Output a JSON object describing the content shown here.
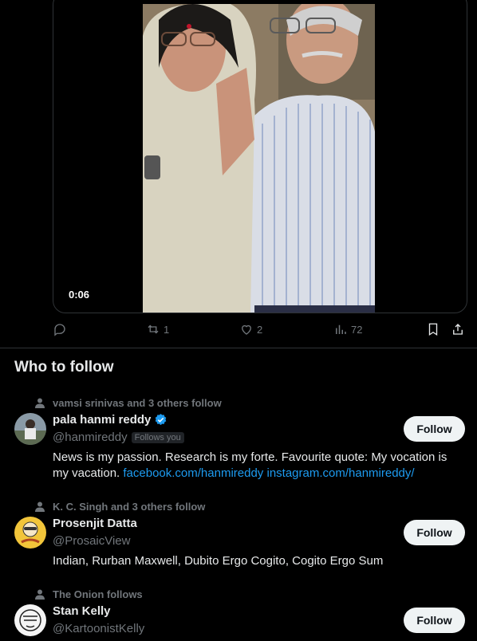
{
  "video": {
    "duration": "0:06"
  },
  "actions": {
    "reposts": "1",
    "likes": "2",
    "views": "72"
  },
  "who_to_follow": {
    "title": "Who to follow",
    "follow_label": "Follow",
    "users": [
      {
        "social": "vamsi srinivas and 3 others follow",
        "name": "pala hanmi reddy",
        "handle": "@hanmireddy",
        "follows_you": "Follows you",
        "bio": "News is my passion. Research is my forte. Favourite quote: My vocation is my vacation.",
        "link1": "facebook.com/hanmireddy",
        "link2": "instagram.com/hanmireddy/"
      },
      {
        "social": "K. C. Singh and 3 others follow",
        "name": "Prosenjit Datta",
        "handle": "@ProsaicView",
        "bio": "Indian, Rurban Maxwell, Dubito Ergo Cogito, Cogito Ergo Sum"
      },
      {
        "social": "The Onion follows",
        "name": "Stan Kelly",
        "handle": "@KartoonistKelly"
      }
    ]
  },
  "colors": {
    "accent": "#1d9bf0",
    "muted": "#71767b",
    "border": "#2f3336",
    "verified": "#1d9bf0"
  }
}
